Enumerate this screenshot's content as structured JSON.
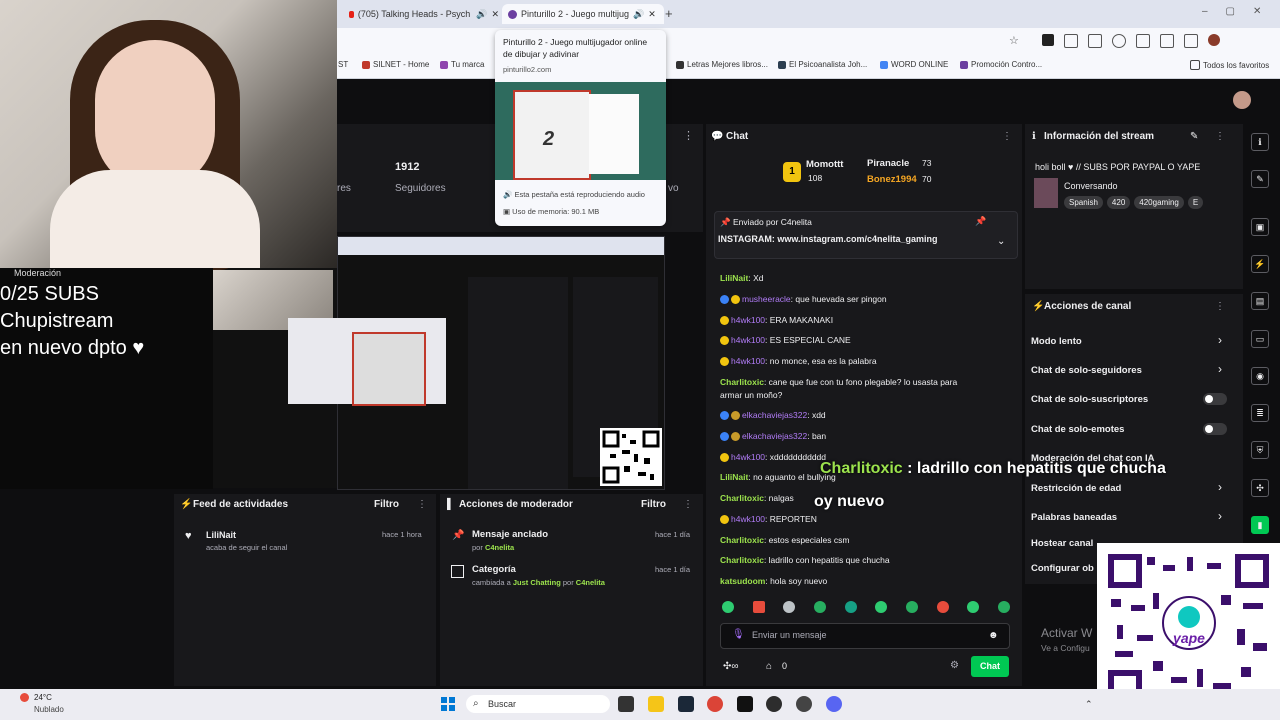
{
  "browser": {
    "tabs": [
      {
        "title": "(705) Talking Heads - Psych"
      },
      {
        "title": "Pinturillo 2 - Juego multijug"
      }
    ],
    "tooltip": {
      "title": "Pinturillo 2 - Juego multijugador online de dibujar y adivinar",
      "domain": "pinturillo2.com",
      "audio_note": "Esta pestaña está reproduciendo audio",
      "memory": "Uso de memoria: 90.1 MB",
      "big_number": "2"
    },
    "bookmarks": [
      "ST",
      "SILNET - Home",
      "Tu marca",
      "Letras Mejores libros...",
      "El Psicoanalista Joh...",
      "WORD ONLINE",
      "Promoción Contro...",
      "Todos los favoritos"
    ]
  },
  "overlay": {
    "subs_line1": "0/25 SUBS",
    "subs_line2": "Chupistream",
    "subs_line3": "en nuevo dpto ♥",
    "moderation_label": "Moderación",
    "caption_user": "Charlitoxic",
    "caption_text": ": ladrillo con hepatitis que chucha",
    "caption_partial": "oy nuevo"
  },
  "stats": {
    "followers_count": "1912",
    "followers_label": "Seguidores",
    "left_clip": "res",
    "right_clip": "vo"
  },
  "activity_feed": {
    "title": "Feed de actividades",
    "filter": "Filtro",
    "items": [
      {
        "user": "LiliNait",
        "action": "acaba de seguir el canal",
        "time": "hace 1 hora"
      }
    ]
  },
  "mod_actions": {
    "title": "Acciones de moderador",
    "filter": "Filtro",
    "items": [
      {
        "title": "Mensaje anclado",
        "by_prefix": "por ",
        "by": "C4nelita",
        "time": "hace 1 día"
      },
      {
        "title": "Categoría",
        "by_prefix": "cambiada a ",
        "category": "Just Chatting",
        "by_mid": " por ",
        "by": "C4nelita",
        "time": "hace 1 día"
      }
    ]
  },
  "chat": {
    "title": "Chat",
    "leaderboard": [
      {
        "name": "Momottt",
        "points": "108"
      },
      {
        "name": "Piranacle",
        "points": "73"
      },
      {
        "name": "Bonez1994",
        "points": "70"
      }
    ],
    "pinned_by_label": "Enviado por",
    "pinned_by": "C4nelita",
    "pinned_text": "INSTAGRAM: www.instagram.com/c4nelita_gaming",
    "messages": [
      {
        "user": "LiliNait",
        "text": ": Xd"
      },
      {
        "user": "musheeracle",
        "text": ": que huevada ser pingon"
      },
      {
        "user": "h4wk100",
        "text": ": ERA MAKANAKI"
      },
      {
        "user": "h4wk100",
        "text": ": ES ESPECIAL CANE"
      },
      {
        "user": "h4wk100",
        "text": ": no monce, esa es la palabra"
      },
      {
        "user": "Charlitoxic",
        "text": ": cane que fue con tu fono plegable? lo usasta para"
      },
      {
        "user": "",
        "text": "armar un moño?"
      },
      {
        "user": "elkachaviejas322",
        "text": ": xdd"
      },
      {
        "user": "elkachaviejas322",
        "text": ": ban"
      },
      {
        "user": "h4wk100",
        "text": ": xddddddddddd"
      },
      {
        "user": "LiliNait",
        "text": ": no aguanto el bullying"
      },
      {
        "user": "Charlitoxic",
        "text": ": nalgas"
      },
      {
        "user": "h4wk100",
        "text": ": REPORTEN"
      },
      {
        "user": "Charlitoxic",
        "text": ": estos especiales csm"
      },
      {
        "user": "Charlitoxic",
        "text": ": ladrillo con hepatitis que chucha"
      },
      {
        "user": "katsudoom",
        "text": ": hola soy nuevo"
      }
    ],
    "input_placeholder": "Enviar un mensaje",
    "points": "0",
    "send": "Chat"
  },
  "stream_info": {
    "title": "Información del stream",
    "stream_title": "holi boll ♥ // SUBS POR PAYPAL O YAPE",
    "category": "Conversando",
    "tags": [
      "Spanish",
      "420",
      "420gaming",
      "E"
    ]
  },
  "channel_actions": {
    "title": "Acciones de canal",
    "items": [
      {
        "label": "Modo lento",
        "control": "chevron"
      },
      {
        "label": "Chat de solo-seguidores",
        "control": "chevron"
      },
      {
        "label": "Chat de solo-suscriptores",
        "control": "toggle"
      },
      {
        "label": "Chat de solo-emotes",
        "control": "toggle"
      },
      {
        "label": "Moderación del chat con IA",
        "control": "none"
      },
      {
        "label": "Restricción de edad",
        "control": "chevron"
      },
      {
        "label": "Palabras baneadas",
        "control": "chevron"
      },
      {
        "label": "Hostear canal",
        "control": "none"
      },
      {
        "label": "Configurar ob",
        "control": "none"
      }
    ]
  },
  "windows_watermark": {
    "line1": "Activar W",
    "line2": "Ve a Configu"
  },
  "taskbar": {
    "temperature": "24°C",
    "weather": "Nublado",
    "search": "Buscar"
  }
}
